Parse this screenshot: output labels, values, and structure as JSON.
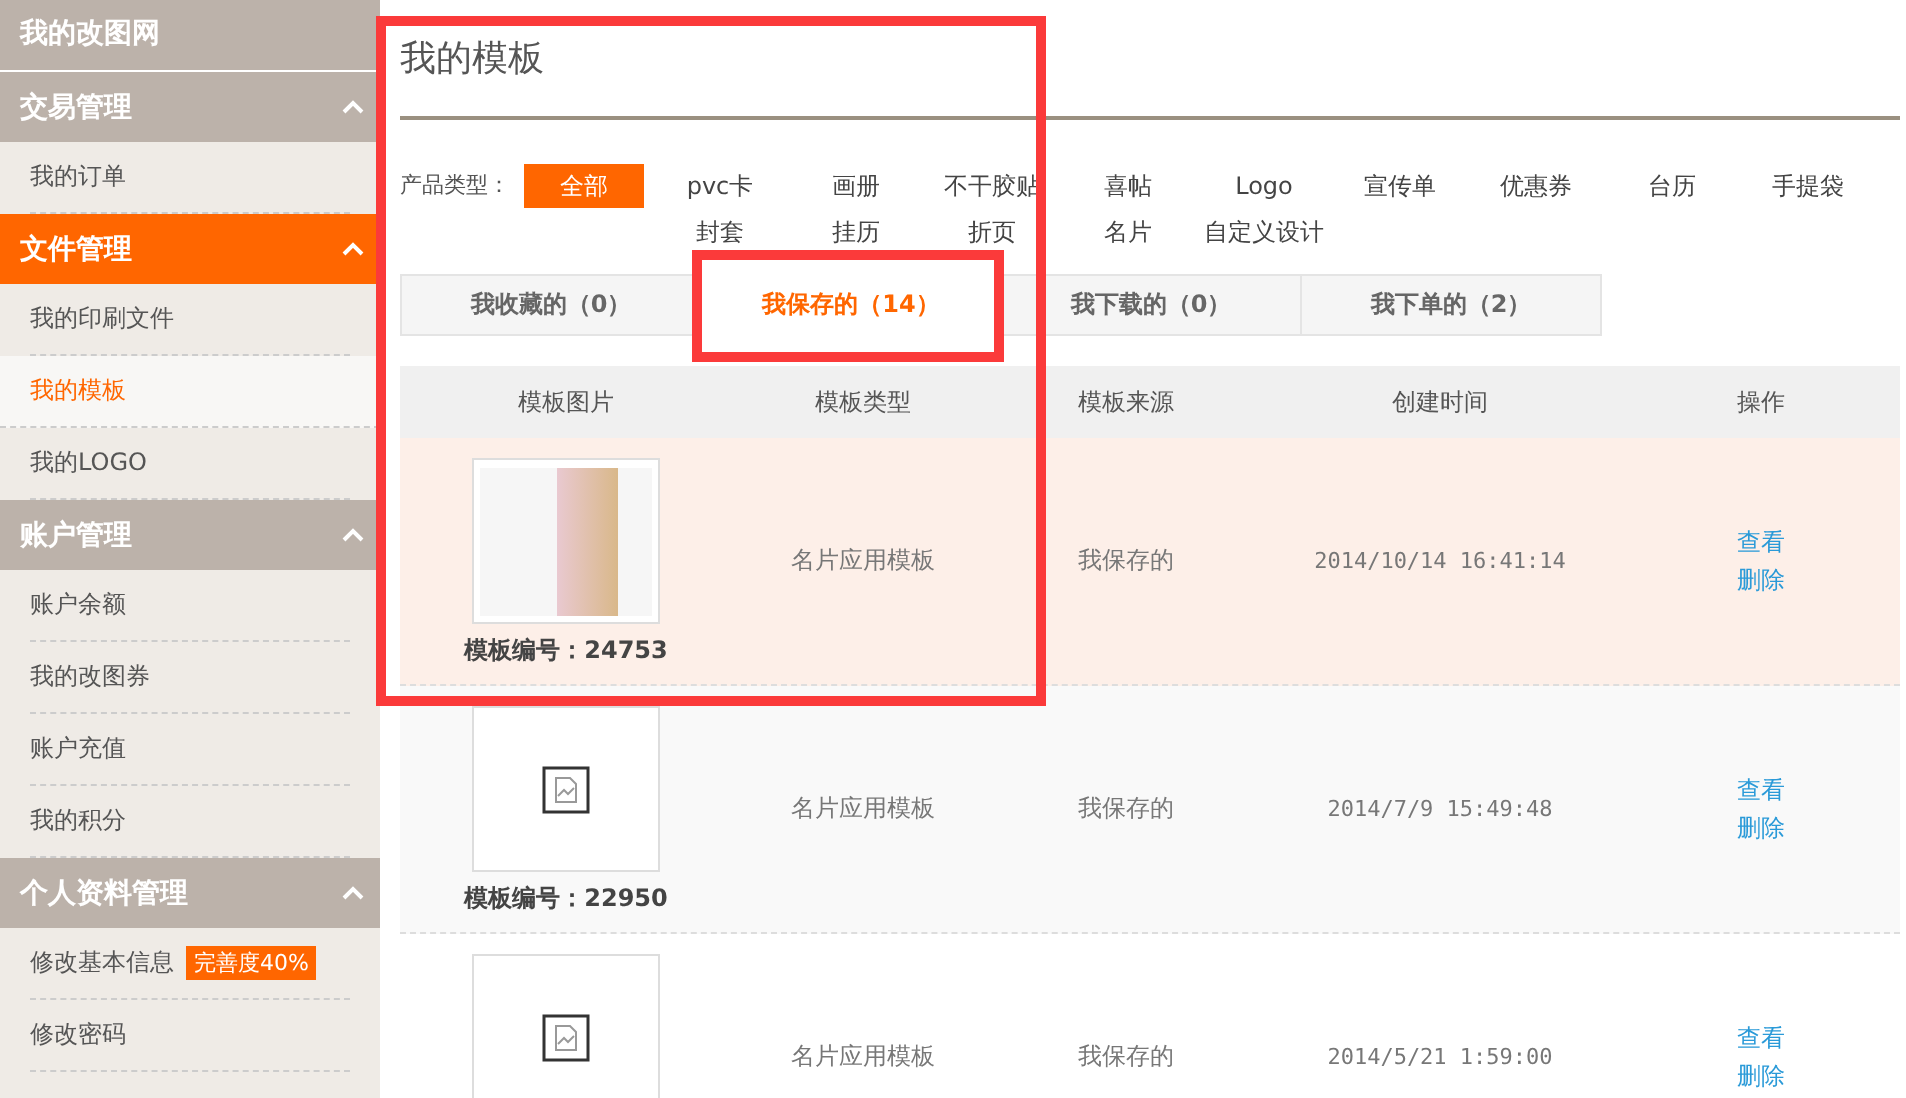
{
  "sidebar": {
    "title": "我的改图网",
    "sections": [
      {
        "label": "交易管理",
        "selected": false,
        "items": [
          {
            "label": "我的订单",
            "selected": false
          }
        ]
      },
      {
        "label": "文件管理",
        "selected": true,
        "items": [
          {
            "label": "我的印刷文件",
            "selected": false
          },
          {
            "label": "我的模板",
            "selected": true
          },
          {
            "label": "我的LOGO",
            "selected": false
          }
        ]
      },
      {
        "label": "账户管理",
        "selected": false,
        "items": [
          {
            "label": "账户余额",
            "selected": false
          },
          {
            "label": "我的改图券",
            "selected": false
          },
          {
            "label": "账户充值",
            "selected": false
          },
          {
            "label": "我的积分",
            "selected": false
          }
        ]
      },
      {
        "label": "个人资料管理",
        "selected": false,
        "items": [
          {
            "label": "修改基本信息",
            "selected": false,
            "badge": "完善度40%"
          },
          {
            "label": "修改密码",
            "selected": false
          }
        ]
      }
    ]
  },
  "page_title": "我的模板",
  "filter": {
    "label": "产品类型：",
    "options": [
      {
        "label": "全部",
        "selected": true
      },
      {
        "label": "pvc卡",
        "selected": false
      },
      {
        "label": "画册",
        "selected": false
      },
      {
        "label": "不干胶贴",
        "selected": false
      },
      {
        "label": "喜帖",
        "selected": false
      },
      {
        "label": "Logo",
        "selected": false
      },
      {
        "label": "宣传单",
        "selected": false
      },
      {
        "label": "优惠券",
        "selected": false
      },
      {
        "label": "台历",
        "selected": false
      },
      {
        "label": "手提袋",
        "selected": false
      },
      {
        "label": "封套",
        "selected": false
      },
      {
        "label": "挂历",
        "selected": false
      },
      {
        "label": "折页",
        "selected": false
      },
      {
        "label": "名片",
        "selected": false
      },
      {
        "label": "自定义设计",
        "selected": false
      }
    ]
  },
  "tabs": [
    {
      "label": "我收藏的（0）",
      "selected": false
    },
    {
      "label": "我保存的（14）",
      "selected": true
    },
    {
      "label": "我下载的（0）",
      "selected": false
    },
    {
      "label": "我下单的（2）",
      "selected": false
    }
  ],
  "table": {
    "columns": [
      "模板图片",
      "模板类型",
      "模板来源",
      "创建时间",
      "操作"
    ],
    "rows": [
      {
        "kind": "photo",
        "code": "模板编号：24753",
        "type": "名片应用模板",
        "source": "我保存的",
        "time": "2014/10/14 16:41:14",
        "actions": [
          "查看",
          "删除"
        ],
        "selected": true
      },
      {
        "kind": "missing",
        "code": "模板编号：22950",
        "type": "名片应用模板",
        "source": "我保存的",
        "time": "2014/7/9 15:49:48",
        "actions": [
          "查看",
          "删除"
        ],
        "selected": false
      },
      {
        "kind": "missing",
        "type": "名片应用模板",
        "source": "我保存的",
        "time": "2014/5/21 1:59:00",
        "actions": [
          "查看",
          "删除"
        ],
        "selected": false
      }
    ]
  }
}
